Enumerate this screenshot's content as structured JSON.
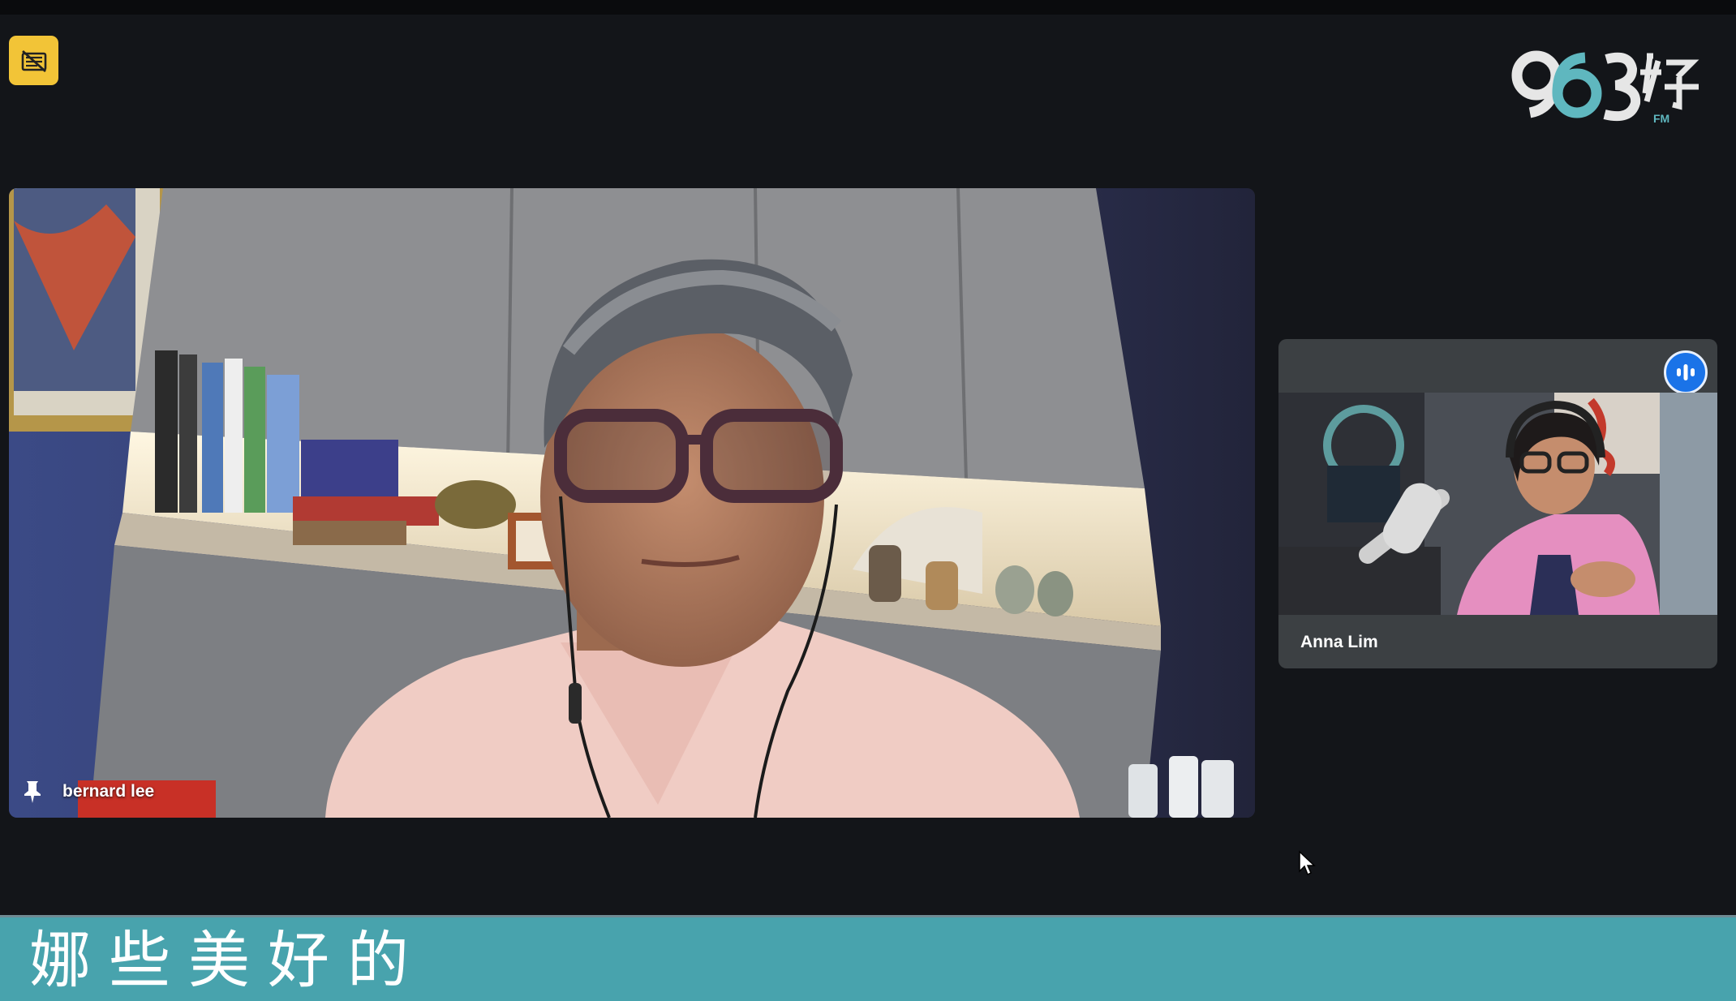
{
  "main_speaker": {
    "name": "bernard lee"
  },
  "participant": {
    "name": "Anna Lim"
  },
  "caption": {
    "text": "娜些美好的"
  },
  "icons": {
    "badge": "video-off-icon",
    "pin": "pin-icon",
    "speaking": "audio-wave-icon",
    "cursor": "mouse-pointer-icon"
  },
  "colors": {
    "background": "#131519",
    "badge": "#f2c437",
    "caption_bar": "#48a3ad",
    "speaking_indicator": "#1a73e8",
    "participant_tile": "#3c4043"
  }
}
